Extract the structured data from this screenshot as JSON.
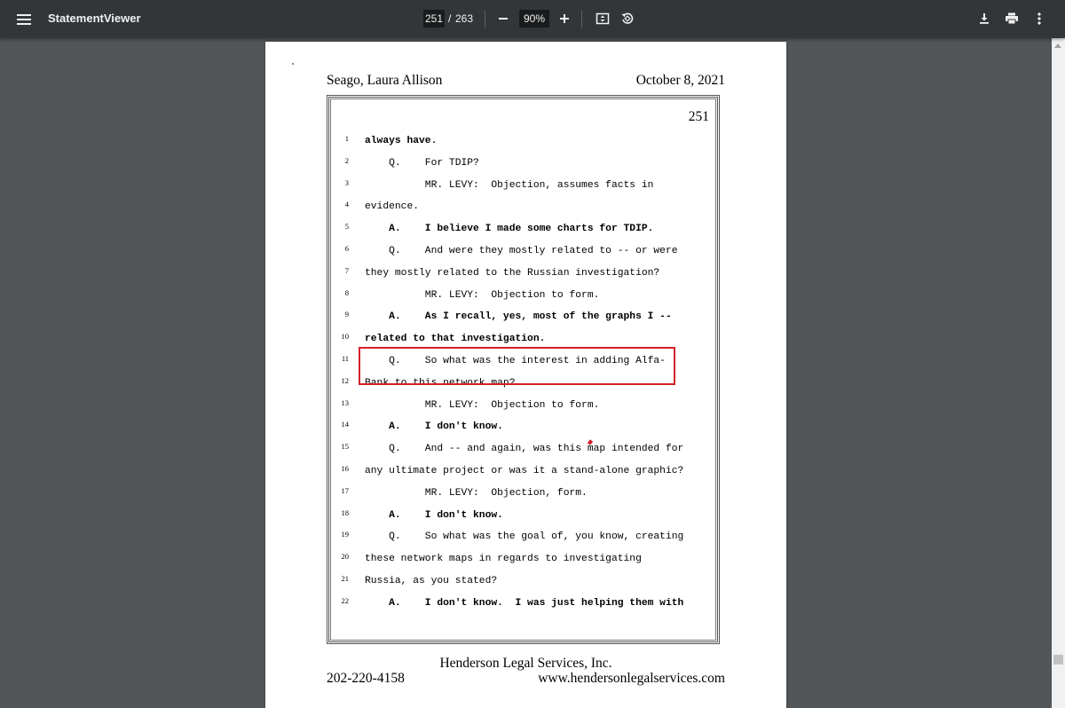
{
  "toolbar": {
    "title": "StatementViewer",
    "page_current": "251",
    "page_separator": "/",
    "page_total": "263",
    "zoom": "90%",
    "icons": [
      "menu-icon",
      "zoom-out-icon",
      "zoom-in-icon",
      "fit-page-icon",
      "rotate-icon",
      "download-icon",
      "print-icon",
      "more-vert-icon"
    ]
  },
  "document": {
    "header_name": "Seago, Laura Allison",
    "header_date": "October 8, 2021",
    "page_number": "251",
    "lines": [
      {
        "n": "1",
        "text": "always have.",
        "bold": true
      },
      {
        "n": "2",
        "text": "    Q.    For TDIP?",
        "bold": false
      },
      {
        "n": "3",
        "text": "          MR. LEVY:  Objection, assumes facts in",
        "bold": false
      },
      {
        "n": "4",
        "text": "evidence.",
        "bold": false
      },
      {
        "n": "5",
        "text": "    A.    I believe I made some charts for TDIP.",
        "bold": true
      },
      {
        "n": "6",
        "text": "    Q.    And were they mostly related to -- or were",
        "bold": false
      },
      {
        "n": "7",
        "text": "they mostly related to the Russian investigation?",
        "bold": false
      },
      {
        "n": "8",
        "text": "          MR. LEVY:  Objection to form.",
        "bold": false
      },
      {
        "n": "9",
        "text": "    A.    As I recall, yes, most of the graphs I --",
        "bold": true
      },
      {
        "n": "10",
        "text": "related to that investigation.",
        "bold": true
      },
      {
        "n": "11",
        "text": "    Q.    So what was the interest in adding Alfa-",
        "bold": false
      },
      {
        "n": "12",
        "text": "Bank to this network map?",
        "bold": false
      },
      {
        "n": "13",
        "text": "          MR. LEVY:  Objection to form.",
        "bold": false
      },
      {
        "n": "14",
        "text": "    A.    I don't know.",
        "bold": true
      },
      {
        "n": "15",
        "text": "    Q.    And -- and again, was this map intended for",
        "bold": false
      },
      {
        "n": "16",
        "text": "any ultimate project or was it a stand-alone graphic?",
        "bold": false
      },
      {
        "n": "17",
        "text": "          MR. LEVY:  Objection, form.",
        "bold": false
      },
      {
        "n": "18",
        "text": "    A.    I don't know.",
        "bold": true
      },
      {
        "n": "19",
        "text": "    Q.    So what was the goal of, you know, creating",
        "bold": false
      },
      {
        "n": "20",
        "text": "these network maps in regards to investigating",
        "bold": false
      },
      {
        "n": "21",
        "text": "Russia, as you stated?",
        "bold": false
      },
      {
        "n": "22",
        "text": "    A.    I don't know.  I was just helping them with",
        "bold": true
      }
    ],
    "footer_company": "Henderson Legal Services, Inc.",
    "footer_phone": "202-220-4158",
    "footer_website": "www.hendersonlegalservices.com",
    "annotation_color": "#d32027"
  }
}
